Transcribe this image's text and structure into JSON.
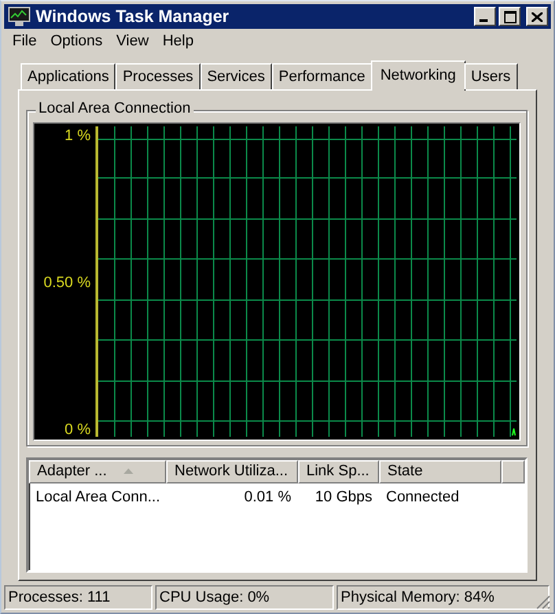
{
  "window": {
    "title": "Windows Task Manager"
  },
  "menu": [
    "File",
    "Options",
    "View",
    "Help"
  ],
  "tabs": [
    {
      "label": "Applications",
      "selected": false
    },
    {
      "label": "Processes",
      "selected": false
    },
    {
      "label": "Services",
      "selected": false
    },
    {
      "label": "Performance",
      "selected": false
    },
    {
      "label": "Networking",
      "selected": true
    },
    {
      "label": "Users",
      "selected": false
    }
  ],
  "group": {
    "title": "Local Area Connection",
    "graph": {
      "y_labels": [
        "1 %",
        "0.50 %",
        "0 %"
      ]
    }
  },
  "table": {
    "columns": [
      {
        "label": "Adapter ...",
        "sorted": true
      },
      {
        "label": "Network Utiliza...",
        "sorted": false
      },
      {
        "label": "Link Sp...",
        "sorted": false
      },
      {
        "label": "State",
        "sorted": false
      }
    ],
    "rows": [
      [
        "Local Area Conn...",
        "0.01 %",
        "10 Gbps",
        "Connected"
      ]
    ]
  },
  "status_bar": [
    "Processes: 111",
    "CPU Usage: 0%",
    "Physical Memory: 84%"
  ]
}
